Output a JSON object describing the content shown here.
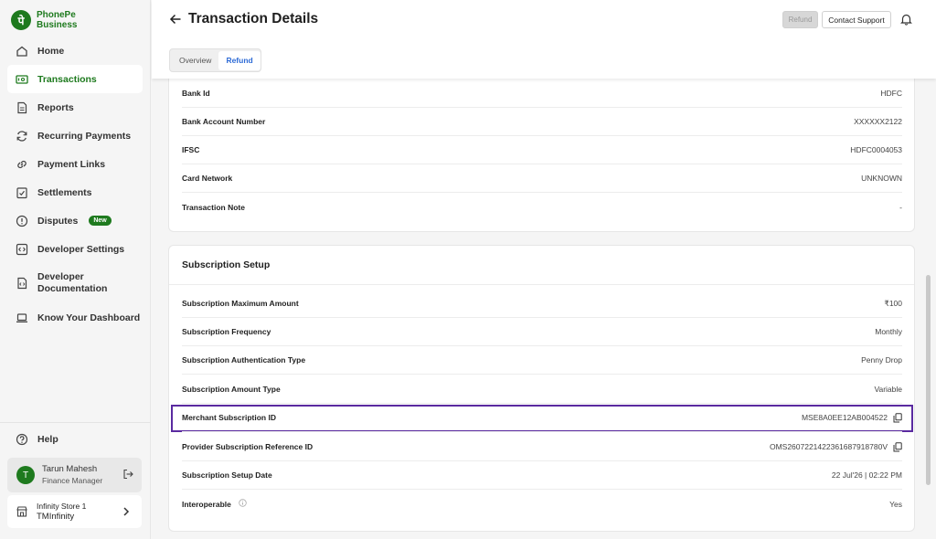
{
  "brand": {
    "line1": "PhonePe",
    "line2": "Business",
    "mark": "पे"
  },
  "nav": [
    {
      "id": "home",
      "label": "Home",
      "icon": "home-icon"
    },
    {
      "id": "transactions",
      "label": "Transactions",
      "icon": "transactions-icon",
      "active": true
    },
    {
      "id": "reports",
      "label": "Reports",
      "icon": "document-icon"
    },
    {
      "id": "recurring-payments",
      "label": "Recurring Payments",
      "icon": "refresh-icon"
    },
    {
      "id": "payment-links",
      "label": "Payment Links",
      "icon": "link-icon"
    },
    {
      "id": "settlements",
      "label": "Settlements",
      "icon": "checklist-icon"
    },
    {
      "id": "disputes",
      "label": "Disputes",
      "icon": "alert-icon",
      "badge": "New"
    },
    {
      "id": "developer-settings",
      "label": "Developer Settings",
      "icon": "code-icon"
    },
    {
      "id": "developer-documentation",
      "label": "Developer Documentation",
      "line1": "Developer",
      "line2": "Documentation",
      "icon": "code-doc-icon"
    },
    {
      "id": "know-your-dashboard",
      "label": "Know Your Dashboard",
      "icon": "laptop-icon"
    }
  ],
  "help": {
    "label": "Help",
    "icon": "help-icon"
  },
  "user": {
    "initial": "T",
    "name": "Tarun Mahesh",
    "role": "Finance Manager"
  },
  "store": {
    "name": "Infinity Store 1",
    "id": "TMInfinity"
  },
  "header": {
    "title": "Transaction Details",
    "refund_button": "Refund",
    "contact_button": "Contact Support"
  },
  "tabs": [
    {
      "label": "Overview",
      "active": false
    },
    {
      "label": "Refund",
      "active": true
    }
  ],
  "bank_details": [
    {
      "label": "Bank Id",
      "value": "HDFC"
    },
    {
      "label": "Bank Account Number",
      "value": "XXXXXX2122"
    },
    {
      "label": "IFSC",
      "value": "HDFC0004053"
    },
    {
      "label": "Card Network",
      "value": "UNKNOWN"
    },
    {
      "label": "Transaction Note",
      "value": "-"
    }
  ],
  "subscription": {
    "title": "Subscription Setup",
    "rows": [
      {
        "label": "Subscription Maximum Amount",
        "value": "₹100"
      },
      {
        "label": "Subscription Frequency",
        "value": "Monthly"
      },
      {
        "label": "Subscription Authentication Type",
        "value": "Penny Drop"
      },
      {
        "label": "Subscription Amount Type",
        "value": "Variable"
      },
      {
        "label": "Merchant Subscription ID",
        "value": "MSE8A0EE12AB004522",
        "copy": true,
        "highlighted": true
      },
      {
        "label": "Provider Subscription Reference ID",
        "value": "OMS2607221422361687918780V",
        "copy": true
      },
      {
        "label": "Subscription Setup Date",
        "value": "22 Jul'26 | 02:22 PM"
      },
      {
        "label": "Interoperable",
        "value": "Yes",
        "info": true
      }
    ]
  },
  "colors": {
    "brand": "#1e7a1e",
    "accent": "#2e6bd6",
    "highlight": "#5a2aa0"
  }
}
